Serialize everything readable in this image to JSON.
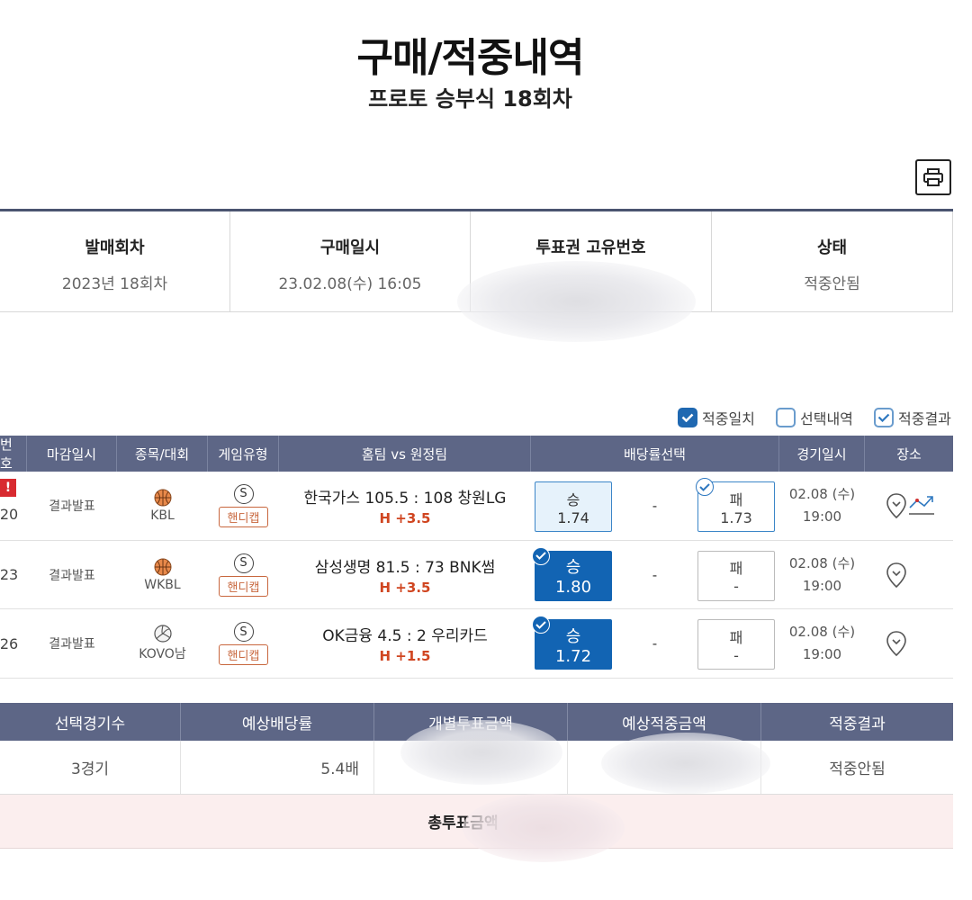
{
  "page": {
    "title": "구매/적중내역",
    "subtitle": "프로토 승부식 18회차"
  },
  "info": {
    "columns": [
      {
        "label": "발매회차",
        "value": "2023년 18회차"
      },
      {
        "label": "구매일시",
        "value": "23.02.08(수) 16:05"
      },
      {
        "label": "투표권 고유번호",
        "value": ""
      },
      {
        "label": "상태",
        "value": "적중안됨"
      }
    ]
  },
  "legend": {
    "items": [
      "적중일치",
      "선택내역",
      "적중결과"
    ]
  },
  "games": {
    "headers": [
      "번호",
      "마감일시",
      "종목/대회",
      "게임유형",
      "홈팀 vs 원정팀",
      "배당률선택",
      "경기일시",
      "장소"
    ],
    "rows": [
      {
        "num": "20",
        "deadline": "결과발표",
        "league": "KBL",
        "type_badge": "S",
        "type_label": "핸디캡",
        "match": "한국가스 105.5 : 108 창원LG",
        "handicap": "H +3.5",
        "win_label": "승",
        "win_odds": "1.74",
        "draw": "-",
        "lose_label": "패",
        "lose_odds": "1.73",
        "date": "02.08 (수)",
        "time": "19:00"
      },
      {
        "num": "23",
        "deadline": "결과발표",
        "league": "WKBL",
        "type_badge": "S",
        "type_label": "핸디캡",
        "match": "삼성생명 81.5 : 73 BNK썸",
        "handicap": "H +3.5",
        "win_label": "승",
        "win_odds": "1.80",
        "draw": "-",
        "lose_label": "패",
        "lose_odds": "-",
        "date": "02.08 (수)",
        "time": "19:00"
      },
      {
        "num": "26",
        "deadline": "결과발표",
        "league": "KOVO남",
        "type_badge": "S",
        "type_label": "핸디캡",
        "match": "OK금융 4.5 : 2 우리카드",
        "handicap": "H +1.5",
        "win_label": "승",
        "win_odds": "1.72",
        "draw": "-",
        "lose_label": "패",
        "lose_odds": "-",
        "date": "02.08 (수)",
        "time": "19:00"
      }
    ]
  },
  "summary": {
    "headers": [
      "선택경기수",
      "예상배당률",
      "개별투표금액",
      "예상적중금액",
      "적중결과"
    ],
    "values": [
      "3경기",
      "5.4배",
      "",
      "",
      "적중안됨"
    ],
    "total_label": "총투표금액"
  },
  "colors": {
    "header_bg": "#5d6686",
    "selected_blue": "#1264b3",
    "handicap_orange": "#c8673e",
    "alert_red": "#d82a30"
  }
}
